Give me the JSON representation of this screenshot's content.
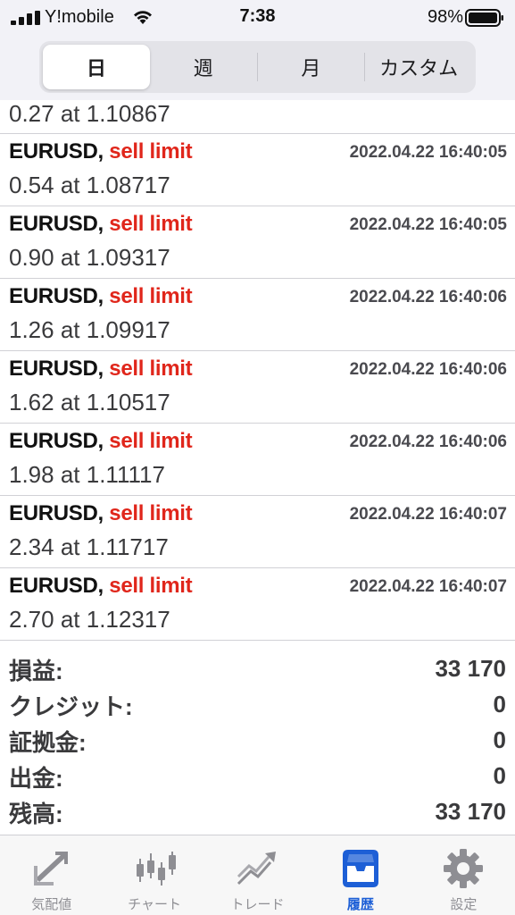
{
  "status_bar": {
    "carrier": "Y!mobile",
    "time": "7:38",
    "battery": "98%"
  },
  "segmented": {
    "tabs": [
      {
        "label": "日",
        "active": true
      },
      {
        "label": "週",
        "active": false
      },
      {
        "label": "月",
        "active": false
      },
      {
        "label": "カスタム",
        "active": false
      }
    ]
  },
  "partial_row": {
    "detail": "0.27 at 1.10867"
  },
  "orders": [
    {
      "symbol": "EURUSD,",
      "type": "sell limit",
      "time": "2022.04.22 16:40:05",
      "detail": "0.54 at 1.08717"
    },
    {
      "symbol": "EURUSD,",
      "type": "sell limit",
      "time": "2022.04.22 16:40:05",
      "detail": "0.90 at 1.09317"
    },
    {
      "symbol": "EURUSD,",
      "type": "sell limit",
      "time": "2022.04.22 16:40:06",
      "detail": "1.26 at 1.09917"
    },
    {
      "symbol": "EURUSD,",
      "type": "sell limit",
      "time": "2022.04.22 16:40:06",
      "detail": "1.62 at 1.10517"
    },
    {
      "symbol": "EURUSD,",
      "type": "sell limit",
      "time": "2022.04.22 16:40:06",
      "detail": "1.98 at 1.11117"
    },
    {
      "symbol": "EURUSD,",
      "type": "sell limit",
      "time": "2022.04.22 16:40:07",
      "detail": "2.34 at 1.11717"
    },
    {
      "symbol": "EURUSD,",
      "type": "sell limit",
      "time": "2022.04.22 16:40:07",
      "detail": "2.70 at 1.12317"
    }
  ],
  "summary": {
    "profit_label": "損益:",
    "profit_value": "33 170",
    "credit_label": "クレジット:",
    "credit_value": "0",
    "deposit_label": "証拠金:",
    "deposit_value": "0",
    "withdrawal_label": "出金:",
    "withdrawal_value": "0",
    "balance_label": "残高:",
    "balance_value": "33 170"
  },
  "tabbar": {
    "tabs": [
      {
        "label": "気配値",
        "icon": "quotes-icon",
        "active": false
      },
      {
        "label": "チャート",
        "icon": "chart-icon",
        "active": false
      },
      {
        "label": "トレード",
        "icon": "trade-icon",
        "active": false
      },
      {
        "label": "履歴",
        "icon": "history-icon",
        "active": true
      },
      {
        "label": "設定",
        "icon": "settings-icon",
        "active": false
      }
    ]
  },
  "colors": {
    "sell": "#e0261b",
    "active_tab": "#1d5fd6",
    "inactive_tab": "#8e8e93"
  }
}
